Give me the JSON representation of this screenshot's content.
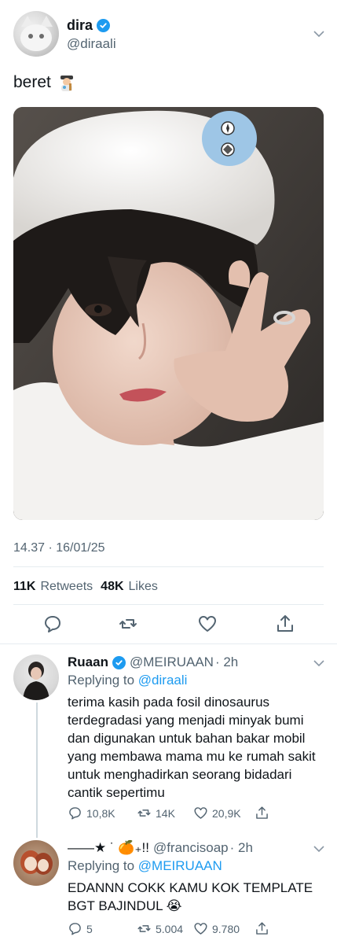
{
  "tweet": {
    "author": {
      "name": "dira",
      "handle": "@diraali",
      "verified": true
    },
    "text": "beret",
    "emoji": "artist",
    "photo_alt_icons": [
      "sparkle-badge",
      "diamond-badge"
    ],
    "timestamp": "14.37 · 16/01/25",
    "stats": {
      "retweets_count": "11K",
      "retweets_label": "Retweets",
      "likes_count": "48K",
      "likes_label": "Likes"
    },
    "actions": [
      "reply-icon",
      "retweet-icon",
      "like-icon",
      "share-icon"
    ]
  },
  "replies": [
    {
      "name": "Ruaan",
      "verified": true,
      "handle": "@MEIRUAAN",
      "time": "· 2h",
      "replying_to_label": "Replying to",
      "replying_to": "@diraali",
      "text": "terima kasih pada fosil dinosaurus terdegradasi yang menjadi minyak bumi dan digunakan untuk bahan bakar mobil yang membawa mama mu ke rumah sakit untuk menghadirkan seorang bidadari cantik sepertimu",
      "replies": "10,8K",
      "retweets": "14K",
      "likes": "20,9K"
    },
    {
      "name": "——★ ˙ 🍊₊!!",
      "verified": false,
      "handle": "@francisoap",
      "time": "· 2h",
      "replying_to_label": "Replying to",
      "replying_to": "@MEIRUAAN",
      "text": "EDANNN COKK KAMU KOK TEMPLATE BGT BAJINDUL 😭",
      "replies": "5",
      "retweets": "5.004",
      "likes": "9.780"
    }
  ],
  "colors": {
    "accent": "#1d9bf0",
    "secondary_text": "#536471",
    "divider": "#e6ecf0"
  }
}
